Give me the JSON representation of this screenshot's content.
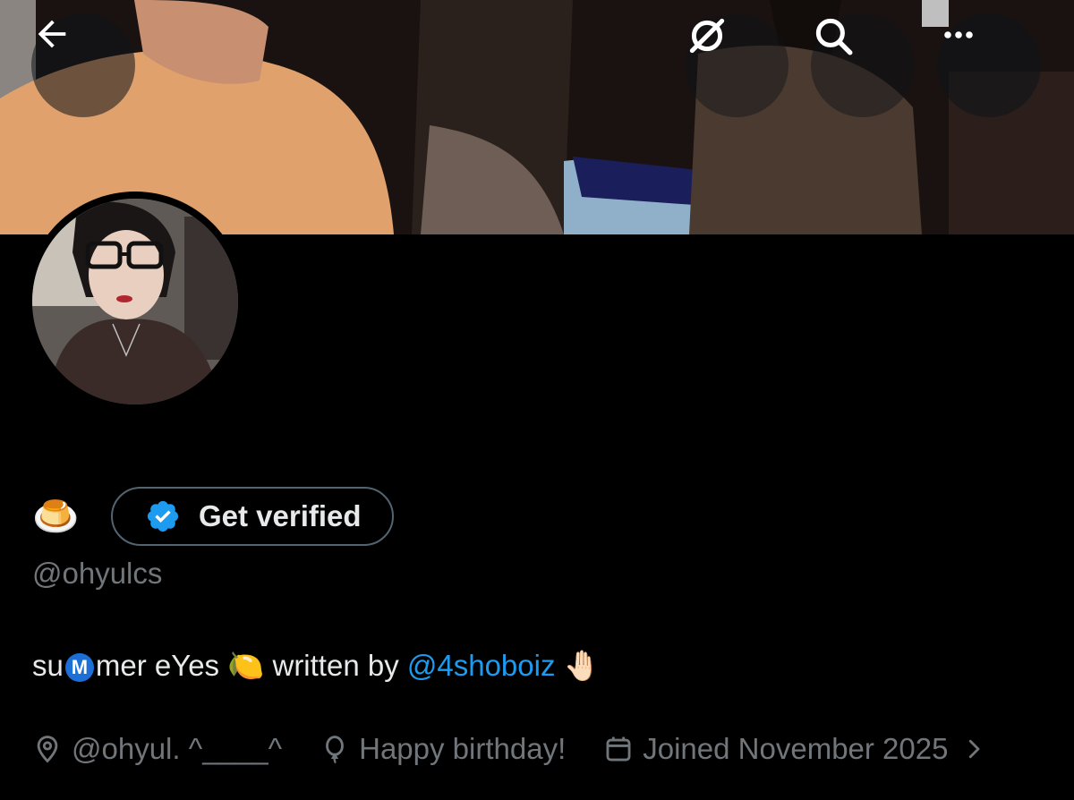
{
  "header": {
    "back_icon": "arrow-left-icon",
    "sync_icon": "grok-sync-icon",
    "search_icon": "search-icon",
    "more_icon": "more-horizontal-icon"
  },
  "profile": {
    "name_emoji": "🍮",
    "verify_button": {
      "label": "Get verified",
      "icon": "verified-badge-icon",
      "badge_color": "#1d9bf0"
    },
    "handle": "@ohyulcs",
    "bio": {
      "part1": "su",
      "m_letter": "M",
      "part2": "mer eYes ",
      "lemon": "🍋",
      "part3": " written by ",
      "mention": "@4shoboiz",
      "hand": " 🤚🏻"
    },
    "meta": {
      "location": "@ohyul. ^____^",
      "birthday": "Happy birthday!",
      "joined": "Joined November 2025"
    }
  },
  "colors": {
    "background": "#000000",
    "text_primary": "#e7e9ea",
    "text_secondary": "#71767b",
    "link": "#1d9bf0",
    "border": "#536471"
  }
}
